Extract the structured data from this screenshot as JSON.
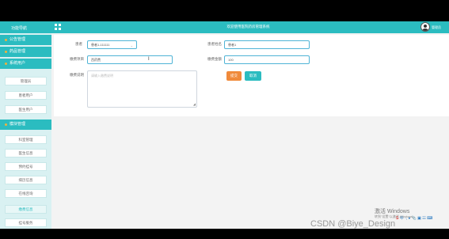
{
  "header": {
    "title": "欢迎使用医院药房管理系统",
    "username": "管理员"
  },
  "sidebar": {
    "logo": "功能导航",
    "sections": [
      {
        "label": "公告管理"
      },
      {
        "label": "药品管理"
      },
      {
        "label": "系统用户"
      }
    ],
    "user_items": [
      {
        "label": "管理员"
      },
      {
        "label": "患者用户"
      },
      {
        "label": "医生用户"
      }
    ],
    "module_head": "模块管理",
    "module_items": [
      {
        "label": "科室管理",
        "active": false
      },
      {
        "label": "医生信息",
        "active": false
      },
      {
        "label": "预约挂号",
        "active": false
      },
      {
        "label": "病历信息",
        "active": false
      },
      {
        "label": "在线咨询",
        "active": false
      },
      {
        "label": "缴费信息",
        "active": true
      },
      {
        "label": "挂号服务",
        "active": false
      }
    ]
  },
  "form": {
    "patient_label": "患者",
    "patient_value": "患者1-111111",
    "patient_caret": "⌄",
    "patient_name_label": "患者姓名",
    "patient_name_value": "患者1",
    "item_label": "缴费项目",
    "item_value": "西药费",
    "amount_label": "缴费金额",
    "amount_value": "100",
    "desc_label": "缴费说明",
    "desc_placeholder": "请输入缴费说明",
    "submit_label": "提交",
    "cancel_label": "取消"
  },
  "system": {
    "tray_text": "中 ·, ♦ 📎 ▣ ☷ ⌨",
    "activate_title": "激活 Windows",
    "activate_sub": "转到\"设置\"以激活 Windows。",
    "watermark": "CSDN @Biye_Design"
  },
  "colors": {
    "accent": "#2bbcc0",
    "submit": "#f08a3b"
  }
}
